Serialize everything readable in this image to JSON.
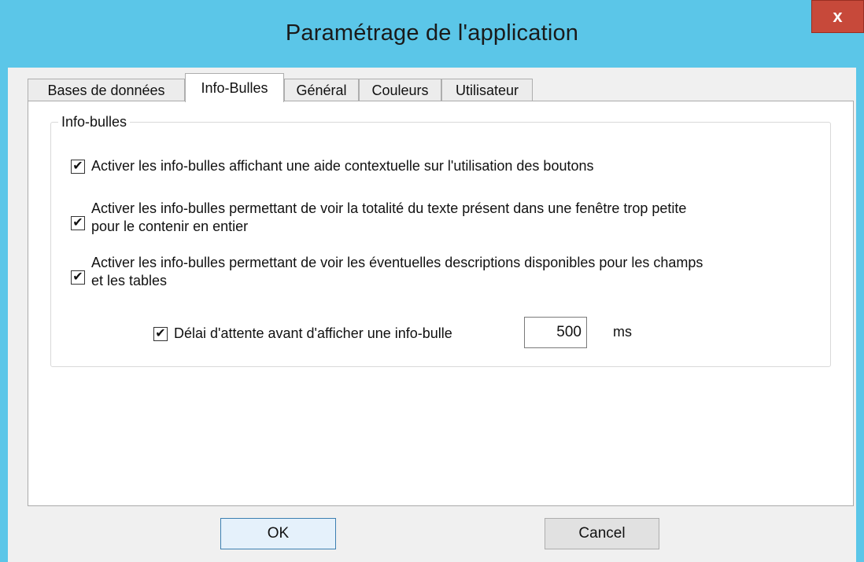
{
  "window": {
    "title": "Paramétrage de l'application",
    "close_label": "x"
  },
  "tabs": [
    {
      "label": "Bases de données",
      "active": false
    },
    {
      "label": "Info-Bulles",
      "active": true
    },
    {
      "label": "Général",
      "active": false
    },
    {
      "label": "Couleurs",
      "active": false
    },
    {
      "label": "Utilisateur",
      "active": false
    }
  ],
  "group": {
    "legend": "Info-bulles",
    "options": [
      {
        "label": "Activer les info-bulles affichant une aide contextuelle sur l'utilisation des boutons",
        "checked": true
      },
      {
        "label_line1": "Activer les info-bulles permettant de voir la totalité du texte présent dans une fenêtre trop petite",
        "label_line2": "pour le contenir en entier",
        "checked": true
      },
      {
        "label_line1": "Activer les info-bulles permettant de voir les éventuelles descriptions disponibles pour les champs",
        "label_line2": "et les tables",
        "checked": true
      }
    ],
    "delay": {
      "label": "Délai d'attente avant d'afficher une info-bulle",
      "checked": true,
      "value": "500",
      "unit": "ms"
    }
  },
  "buttons": {
    "ok": "OK",
    "cancel": "Cancel"
  },
  "colors": {
    "titlebar": "#5bc6e8",
    "close": "#c7493a",
    "client": "#f0f0f0"
  },
  "icons": {
    "check": "✔"
  }
}
